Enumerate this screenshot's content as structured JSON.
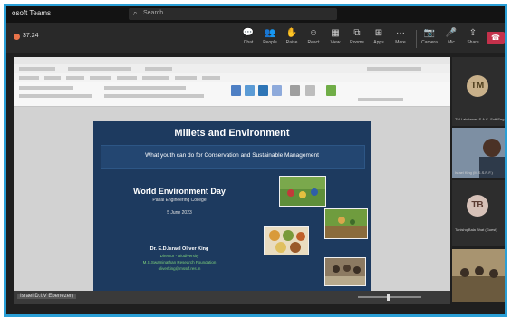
{
  "app": {
    "title": "osoft Teams",
    "search_placeholder": "Search"
  },
  "meeting": {
    "timer": "37:24",
    "controls": [
      {
        "label": "Chat",
        "icon": "chat-icon",
        "glyph": "💬"
      },
      {
        "label": "People",
        "icon": "people-icon",
        "glyph": "👥"
      },
      {
        "label": "Raise",
        "icon": "raise-hand-icon",
        "glyph": "✋"
      },
      {
        "label": "React",
        "icon": "react-icon",
        "glyph": "☺"
      },
      {
        "label": "View",
        "icon": "view-icon",
        "glyph": "▦"
      },
      {
        "label": "Rooms",
        "icon": "rooms-icon",
        "glyph": "⧉"
      },
      {
        "label": "Apps",
        "icon": "apps-icon",
        "glyph": "⊞"
      },
      {
        "label": "More",
        "icon": "more-icon",
        "glyph": "···"
      },
      {
        "label": "Camera",
        "icon": "camera-icon",
        "glyph": "📷"
      },
      {
        "label": "Mic",
        "icon": "mic-icon",
        "glyph": "🎤"
      },
      {
        "label": "Share",
        "icon": "share-icon",
        "glyph": "⇪"
      }
    ],
    "leave_icon": "phone-hangup-icon",
    "leave_glyph": "☎"
  },
  "slide": {
    "title": "Millets and Environment",
    "subtitle": "What youth can do for Conservation and Sustainable Management",
    "event": "World Environment Day",
    "college": "Panai Engineering College",
    "date": "5 June 2023",
    "speaker": "Dr. E.D.Israel Oliver King",
    "speaker_lines": [
      "Director - Biodiversity",
      "M.S.Swaminathan Research Foundation",
      "oliverking@mssrf.res.in"
    ]
  },
  "status": {
    "left_text": "Israel D.I.V Ebenezer)"
  },
  "participants": [
    {
      "initials": "TM",
      "name": "TM Lakshman S.A.C. Soft Eng",
      "color": "#c8b08a"
    },
    {
      "initials": "",
      "name": "Israel King (M.S.S.R.F.)",
      "color": "#6b7b8f"
    },
    {
      "initials": "TB",
      "name": "Tanishq Bala Bhat (Guest)",
      "color": "#d6c1b8"
    },
    {
      "initials": "",
      "name": "",
      "color": "#8a7a5a"
    }
  ],
  "colors": {
    "accent_border": "#2a9fd6",
    "slide_bg": "#1d3a5f",
    "leave_red": "#c4314b",
    "speaker_green": "#7fd27b"
  }
}
